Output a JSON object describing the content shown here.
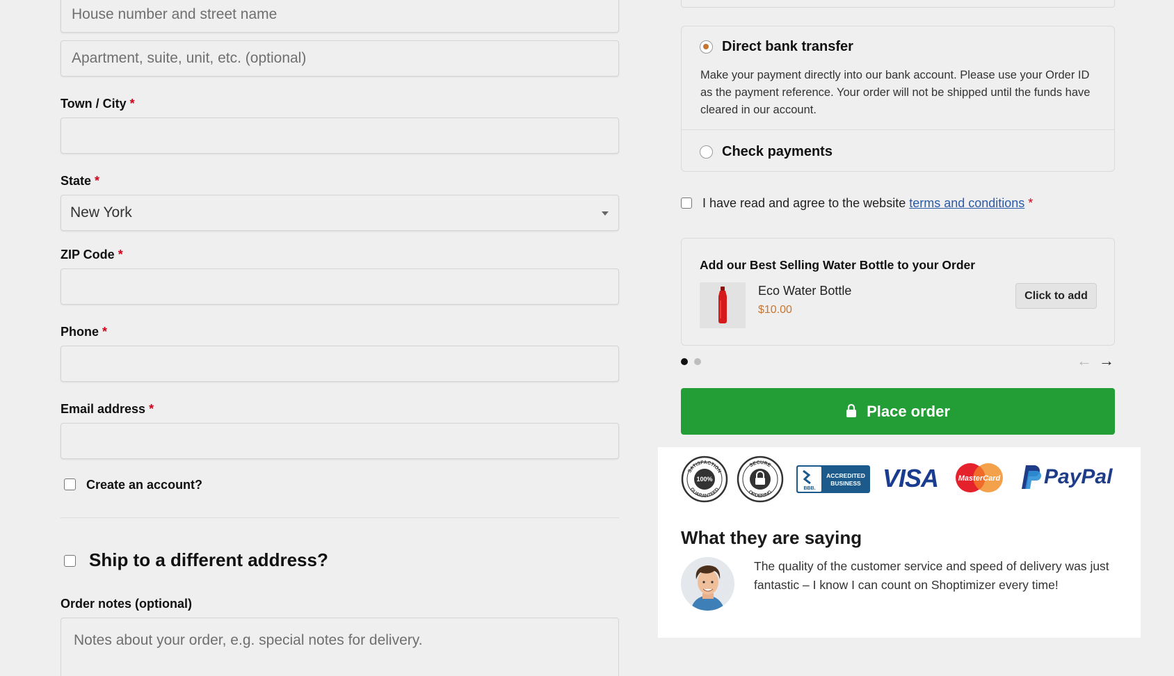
{
  "billing": {
    "street_placeholder": "House number and street name",
    "apartment_placeholder": "Apartment, suite, unit, etc. (optional)",
    "town_label": "Town / City",
    "state_label": "State",
    "state_value": "New York",
    "zip_label": "ZIP Code",
    "phone_label": "Phone",
    "email_label": "Email address",
    "required_mark": "*",
    "create_account_label": "Create an account?",
    "ship_different_label": "Ship to a different address?",
    "order_notes_label": "Order notes (optional)",
    "order_notes_placeholder": "Notes about your order, e.g. special notes for delivery."
  },
  "payment": {
    "methods": [
      {
        "title": "Direct bank transfer",
        "selected": true,
        "description": "Make your payment directly into our bank account. Please use your Order ID as the payment reference. Your order will not be shipped until the funds have cleared in our account."
      },
      {
        "title": "Check payments",
        "selected": false
      }
    ],
    "terms_prefix": "I have read and agree to the website ",
    "terms_link": "terms and conditions",
    "terms_required": "*"
  },
  "upsell": {
    "title": "Add our Best Selling Water Bottle to your Order",
    "product_name": "Eco Water Bottle",
    "product_price": "$10.00",
    "add_button": "Click to add",
    "prev_arrow": "←",
    "next_arrow": "→"
  },
  "place_order_label": "Place order",
  "trust": {
    "badge_satisfaction_top": "SATISFACTION",
    "badge_satisfaction_center": "100%",
    "badge_satisfaction_bottom": "GUARANTEED",
    "badge_secure_top": "SECURE",
    "badge_secure_bottom": "ORDERING",
    "bbb_line1": "ACCREDITED",
    "bbb_line2": "BUSINESS",
    "bbb_logo": "BBB.",
    "visa": "VISA",
    "mastercard": "MasterCard",
    "paypal": "PayPal"
  },
  "testimonial": {
    "title": "What they are saying",
    "quote": "The quality of the customer service and speed of delivery was just fantastic – I know I can count on Shoptimizer every time!"
  },
  "colors": {
    "accent_green": "#239e36",
    "price_orange": "#c8752f",
    "required_red": "#d0021b",
    "link_blue": "#2a5aa8"
  }
}
